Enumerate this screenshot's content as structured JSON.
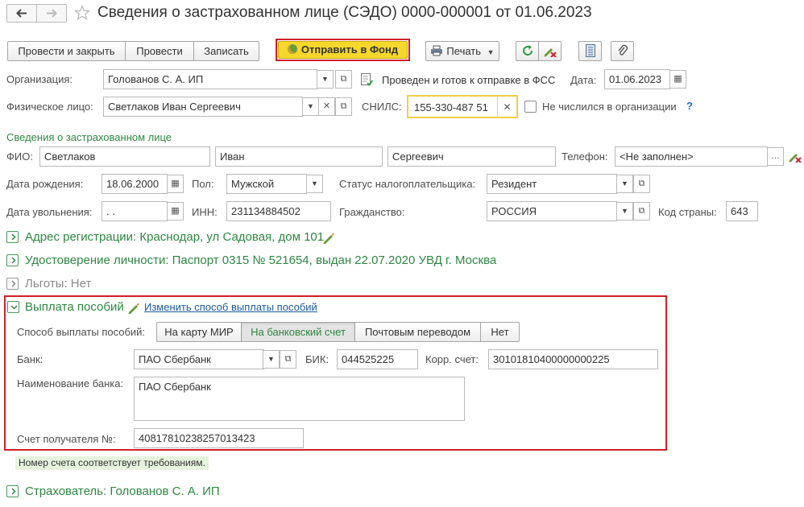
{
  "window": {
    "title": "Сведения о застрахованном лице (СЭДО) 0000-000001 от 01.06.2023",
    "back_icon": "arrow-left-icon",
    "forward_icon": "arrow-right-icon",
    "favorite_icon": "star-icon"
  },
  "toolbar": {
    "post_close_label": "Провести и закрыть",
    "post_label": "Провести",
    "save_label": "Записать",
    "send_label": "Отправить в Фонд",
    "print_label": "Печать",
    "accent_red": "#d0202a",
    "send_bg": "#f5d82b"
  },
  "header": {
    "org_label": "Организация:",
    "org_value": "Голованов С. А. ИП",
    "status_text": "Проведен и готов к отправке в ФСС",
    "date_label": "Дата:",
    "date_value": "01.06.2023",
    "person_label": "Физическое лицо:",
    "person_value": "Светлаков Иван Сергеевич",
    "snils_label": "СНИЛС:",
    "snils_value": "155-330-487 51",
    "not_listed_label": "Не числился в организации",
    "help_mark": "?"
  },
  "insured": {
    "group_title": "Сведения о застрахованном лице",
    "fio_label": "ФИО:",
    "last_name": "Светлаков",
    "first_name": "Иван",
    "middle_name": "Сергеевич",
    "phone_label": "Телефон:",
    "phone_value": "<Не заполнен>",
    "birth_label": "Дата рождения:",
    "birth_value": "18.06.2000",
    "gender_label": "Пол:",
    "gender_value": "Мужской",
    "tax_status_label": "Статус налогоплательщика:",
    "tax_status_value": "Резидент",
    "dismissal_label": "Дата увольнения:",
    "dismissal_value": " .  .",
    "inn_label": "ИНН:",
    "inn_value": "231134884502",
    "citizenship_label": "Гражданство:",
    "citizenship_value": "РОССИЯ",
    "country_code_label": "Код страны:",
    "country_code_value": "643"
  },
  "sections": {
    "address": "Адрес регистрации: Краснодар, ул Садовая, дом 101",
    "identity": "Удостоверение личности: Паспорт 0315 № 521654, выдан 22.07.2020 УВД г. Москва",
    "benefits": "Льготы: Нет",
    "payment_title": "Выплата пособий",
    "payment_change_link": "Изменить способ выплаты пособий",
    "insurer": "Страхователь: Голованов С. А. ИП"
  },
  "payment": {
    "method_label": "Способ выплаты пособий:",
    "methods": [
      "На карту МИР",
      "На банковский счет",
      "Почтовым переводом",
      "Нет"
    ],
    "selected_index": 1,
    "bank_label": "Банк:",
    "bank_value": "ПАО Сбербанк",
    "bik_label": "БИК:",
    "bik_value": "044525225",
    "corr_label": "Корр. счет:",
    "corr_value": "30101810400000000225",
    "bank_name_label": "Наименование банка:",
    "bank_name_value": "ПАО Сбербанк",
    "account_label": "Счет получателя №:",
    "account_value": "40817810238257013423",
    "validation_message": "Номер счета соответствует требованиям."
  }
}
